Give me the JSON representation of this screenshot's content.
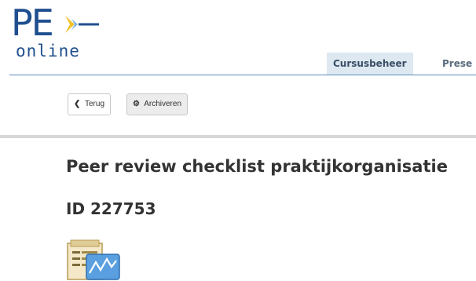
{
  "logo": {
    "main": "PE",
    "sub": "online"
  },
  "tabs": [
    {
      "label": "Cursusbeheer",
      "active": true
    },
    {
      "label": "Prese",
      "active": false
    }
  ],
  "toolbar": {
    "back_label": "Terug",
    "back_icon": "chevron-left-icon",
    "archive_label": "Archiveren",
    "archive_icon": "gear-icon"
  },
  "page": {
    "title": "Peer review checklist praktijkorganisatie",
    "id_text": "ID 227753",
    "icon": "checklist-chart-icon"
  },
  "colors": {
    "brand_blue": "#1f4f8f",
    "accent_yellow": "#f2c230",
    "active_tab_bg": "#dde8f0",
    "header_rule": "#5a8ac0"
  }
}
